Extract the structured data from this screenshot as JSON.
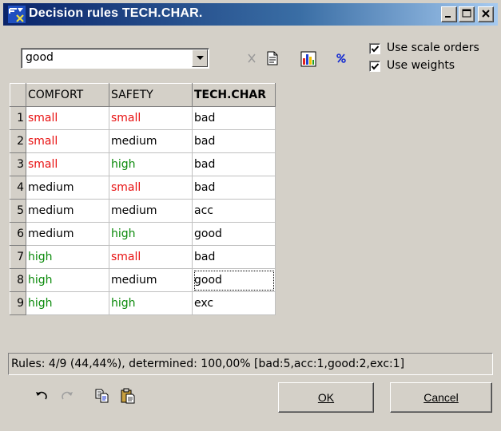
{
  "window": {
    "title": "Decision rules TECH.CHAR."
  },
  "toolbar": {
    "combo_value": "good",
    "icons": [
      "cut-icon",
      "document-icon",
      "chart-icon",
      "percent-icon"
    ],
    "use_scale_orders": {
      "label": "Use scale orders",
      "checked": true
    },
    "use_weights": {
      "label": "Use weights",
      "checked": true
    }
  },
  "grid": {
    "headers": [
      "COMFORT",
      "SAFETY",
      "TECH.CHAR"
    ],
    "rows": [
      {
        "n": "1",
        "comfort": "small",
        "safety": "small",
        "tech": "bad",
        "c_color": "red",
        "s_color": "red",
        "tech_bold": false
      },
      {
        "n": "2",
        "comfort": "small",
        "safety": "medium",
        "tech": "bad",
        "c_color": "red",
        "s_color": "black",
        "tech_bold": false
      },
      {
        "n": "3",
        "comfort": "small",
        "safety": "high",
        "tech": "bad",
        "c_color": "red",
        "s_color": "green",
        "tech_bold": true
      },
      {
        "n": "4",
        "comfort": "medium",
        "safety": "small",
        "tech": "bad",
        "c_color": "black",
        "s_color": "red",
        "tech_bold": false
      },
      {
        "n": "5",
        "comfort": "medium",
        "safety": "medium",
        "tech": "acc",
        "c_color": "black",
        "s_color": "black",
        "tech_bold": true
      },
      {
        "n": "6",
        "comfort": "medium",
        "safety": "high",
        "tech": "good",
        "c_color": "black",
        "s_color": "green",
        "tech_bold": false
      },
      {
        "n": "7",
        "comfort": "high",
        "safety": "small",
        "tech": "bad",
        "c_color": "green",
        "s_color": "red",
        "tech_bold": true
      },
      {
        "n": "8",
        "comfort": "high",
        "safety": "medium",
        "tech": "good",
        "c_color": "green",
        "s_color": "black",
        "tech_bold": false
      },
      {
        "n": "9",
        "comfort": "high",
        "safety": "high",
        "tech": "exc",
        "c_color": "green",
        "s_color": "green",
        "tech_bold": true
      }
    ]
  },
  "status": {
    "text": "Rules: 4/9 (44,44%), determined: 100,00% [bad:5,acc:1,good:2,exc:1]"
  },
  "footer": {
    "icons": [
      "undo-icon",
      "redo-icon",
      "copy-icon",
      "paste-icon"
    ],
    "ok_label": "OK",
    "cancel_label": "Cancel"
  },
  "colors": {
    "red": "#e81010",
    "green": "#0a8a0a",
    "title_start": "#0a246a",
    "title_end": "#a6caf0"
  }
}
